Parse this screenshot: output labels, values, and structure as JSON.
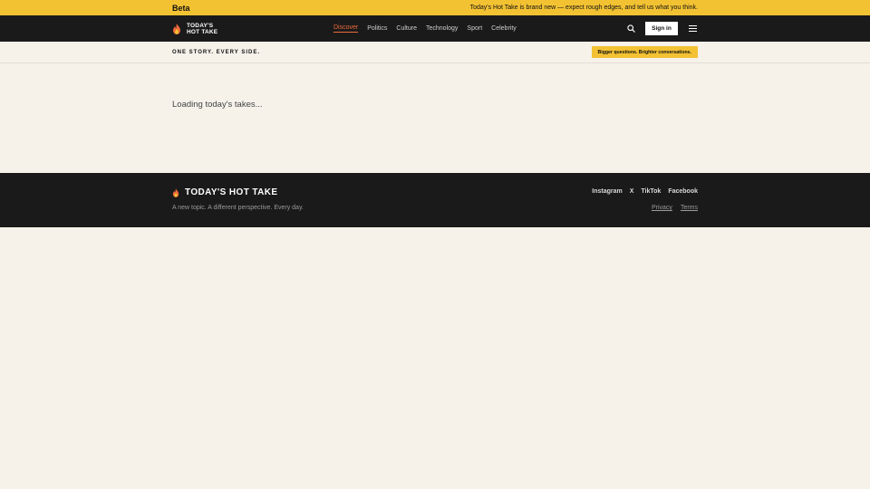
{
  "beta_bar": {
    "tag": "Beta",
    "message": "Today's Hot Take is brand new — expect rough edges, and tell us what you think."
  },
  "header": {
    "brand_line1": "TODAY'S",
    "brand_line2": "HOT TAKE",
    "nav": [
      "Discover",
      "Politics",
      "Culture",
      "Technology",
      "Sport",
      "Celebrity"
    ],
    "active_nav": "Discover",
    "signin_label": "Sign in",
    "icons": {
      "logo": "flame-icon",
      "search": "search-icon",
      "menu": "menu-icon"
    }
  },
  "tagline_row": {
    "tagline": "ONE STORY. EVERY SIDE.",
    "promo": "Bigger questions. Brighter conversations."
  },
  "main": {
    "loading_text": "Loading today's takes..."
  },
  "footer": {
    "brand": "TODAY'S HOT TAKE",
    "tagline": "A new topic. A different perspective. Every day.",
    "social": [
      "Instagram",
      "X",
      "TikTok",
      "Facebook"
    ],
    "legal": [
      "Privacy",
      "Terms"
    ]
  },
  "colors": {
    "accent_yellow": "#f3c233",
    "dark": "#1a1a1a",
    "background": "#f6f2ea",
    "flame_orange": "#f06a3a"
  }
}
